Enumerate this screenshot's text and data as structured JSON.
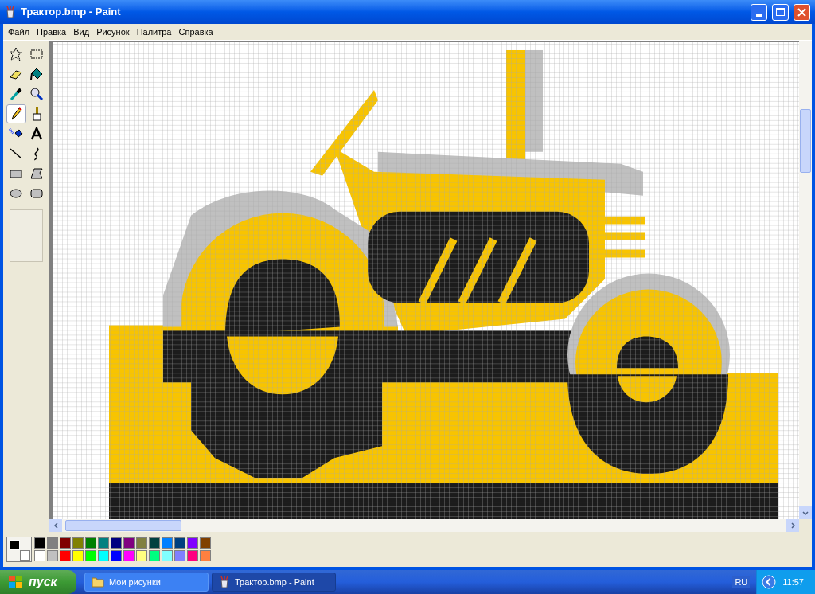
{
  "window": {
    "title": "Трактор.bmp - Paint"
  },
  "menu": [
    "Файл",
    "Правка",
    "Вид",
    "Рисунок",
    "Палитра",
    "Справка"
  ],
  "tools": [
    {
      "kind": "free-select",
      "selected": false
    },
    {
      "kind": "select",
      "selected": false
    },
    {
      "kind": "eraser",
      "selected": false
    },
    {
      "kind": "fill",
      "selected": false
    },
    {
      "kind": "picker",
      "selected": false
    },
    {
      "kind": "magnifier",
      "selected": false
    },
    {
      "kind": "pencil",
      "selected": true
    },
    {
      "kind": "brush",
      "selected": false
    },
    {
      "kind": "airbrush",
      "selected": false
    },
    {
      "kind": "text",
      "selected": false
    },
    {
      "kind": "line",
      "selected": false
    },
    {
      "kind": "curve",
      "selected": false
    },
    {
      "kind": "rectangle",
      "selected": false
    },
    {
      "kind": "polygon",
      "selected": false
    },
    {
      "kind": "ellipse",
      "selected": false
    },
    {
      "kind": "rounded-rectangle",
      "selected": false
    }
  ],
  "current_colors": [
    {
      "kind": "foreground",
      "color": "#000000"
    },
    {
      "kind": "background",
      "color": "#ffffff"
    }
  ],
  "palette": [
    {
      "color": "#000000"
    },
    {
      "color": "#808080"
    },
    {
      "color": "#800000"
    },
    {
      "color": "#808000"
    },
    {
      "color": "#008000"
    },
    {
      "color": "#008080"
    },
    {
      "color": "#000080"
    },
    {
      "color": "#800080"
    },
    {
      "color": "#808040"
    },
    {
      "color": "#004040"
    },
    {
      "color": "#0080ff"
    },
    {
      "color": "#004080"
    },
    {
      "color": "#8000ff"
    },
    {
      "color": "#804000"
    },
    {
      "color": "#ffffff"
    },
    {
      "color": "#c0c0c0"
    },
    {
      "color": "#ff0000"
    },
    {
      "color": "#ffff00"
    },
    {
      "color": "#00ff00"
    },
    {
      "color": "#00ffff"
    },
    {
      "color": "#0000ff"
    },
    {
      "color": "#ff00ff"
    },
    {
      "color": "#ffff80"
    },
    {
      "color": "#00ff80"
    },
    {
      "color": "#80ffff"
    },
    {
      "color": "#8080ff"
    },
    {
      "color": "#ff0080"
    },
    {
      "color": "#ff8040"
    }
  ],
  "taskbar": {
    "start": "пуск",
    "tasks": [
      {
        "kind": "folder",
        "label": "Мои рисунки",
        "selected": false
      },
      {
        "kind": "paint",
        "label": "Трактор.bmp - Paint",
        "selected": true
      }
    ],
    "language": "RU",
    "clock": "11:57"
  }
}
